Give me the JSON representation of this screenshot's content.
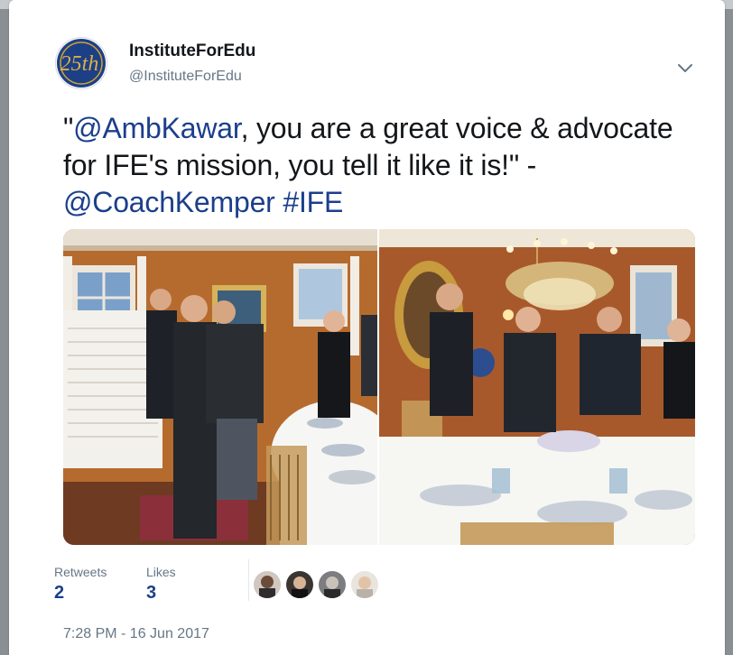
{
  "author": {
    "name": "InstituteForEdu",
    "handle": "@InstituteForEdu",
    "avatar_text": "25th"
  },
  "tweet": {
    "segments": [
      {
        "text": "\"",
        "link": false
      },
      {
        "text": "@AmbKawar",
        "link": true
      },
      {
        "text": ", you are a great voice & advocate for IFE's mission, you tell it like it is!\" -",
        "link": false
      },
      {
        "text": "@CoachKemper",
        "link": true
      },
      {
        "text": " ",
        "link": false
      },
      {
        "text": "#IFE",
        "link": true
      }
    ]
  },
  "stats": {
    "retweets_label": "Retweets",
    "retweets_count": "2",
    "likes_label": "Likes",
    "likes_count": "3"
  },
  "timestamp": "7:28 PM - 16 Jun 2017",
  "icons": {
    "menu": "chevron-down-icon"
  },
  "colors": {
    "link": "#1b3f8b",
    "secondary_text": "#657786"
  }
}
